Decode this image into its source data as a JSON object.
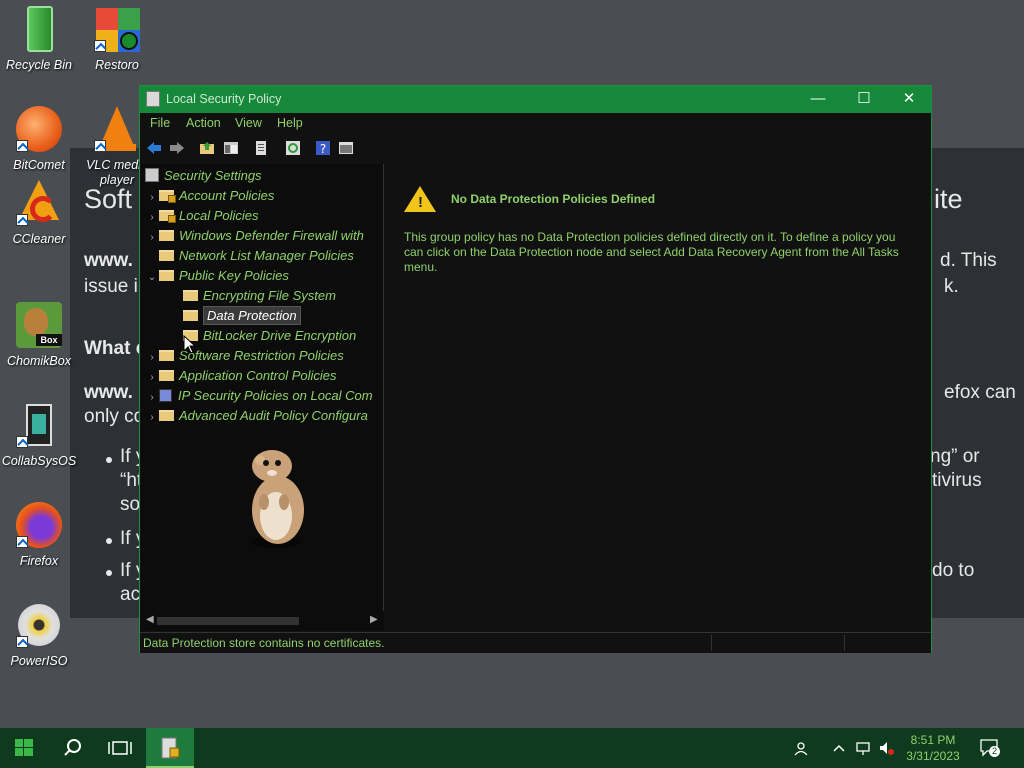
{
  "desktop_icons": [
    {
      "label": "Recycle Bin",
      "icon": "recycle-bin-icon"
    },
    {
      "label": "Restoro",
      "icon": "restoro-icon"
    },
    {
      "label": "BitComet",
      "icon": "bitcomet-icon"
    },
    {
      "label": "VLC media player",
      "icon": "vlc-icon"
    },
    {
      "label": "CCleaner",
      "icon": "ccleaner-icon"
    },
    {
      "label": "ChomikBox",
      "icon": "chomikbox-icon"
    },
    {
      "label": "CollabSysOS",
      "icon": "collabsysos-icon"
    },
    {
      "label": "Firefox",
      "icon": "firefox-icon"
    },
    {
      "label": "PowerISO",
      "icon": "poweriso-icon"
    }
  ],
  "background_page": {
    "fragments": [
      "Soft",
      "ite",
      "www.",
      "d. This",
      "issue i",
      "k.",
      "What c",
      "www.",
      "efox can",
      "only co",
      "If y",
      "ng” or",
      "“ht",
      "tivirus",
      "so",
      "If y",
      "If y",
      "do to",
      "ac"
    ]
  },
  "window": {
    "title": "Local Security Policy",
    "controls": {
      "minimize": "—",
      "maximize": "☐",
      "close": "✕"
    },
    "menu": [
      "File",
      "Action",
      "View",
      "Help"
    ],
    "tree": {
      "root": "Security Settings",
      "items": [
        {
          "label": "Account Policies",
          "level": 1,
          "expand": "›"
        },
        {
          "label": "Local Policies",
          "level": 1,
          "expand": "›"
        },
        {
          "label": "Windows Defender Firewall with",
          "level": 1,
          "expand": "›"
        },
        {
          "label": "Network List Manager Policies",
          "level": 1,
          "expand": ""
        },
        {
          "label": "Public Key Policies",
          "level": 1,
          "expand": "⌄"
        },
        {
          "label": "Encrypting File System",
          "level": 2,
          "expand": ""
        },
        {
          "label": "Data Protection",
          "level": 2,
          "expand": "",
          "selected": true
        },
        {
          "label": "BitLocker Drive Encryption",
          "level": 2,
          "expand": ""
        },
        {
          "label": "Software Restriction Policies",
          "level": 1,
          "expand": "›"
        },
        {
          "label": "Application Control Policies",
          "level": 1,
          "expand": "›"
        },
        {
          "label": "IP Security Policies on Local Com",
          "level": 1,
          "expand": "›"
        },
        {
          "label": "Advanced Audit Policy Configura",
          "level": 1,
          "expand": "›"
        }
      ]
    },
    "detail": {
      "title": "No Data Protection Policies Defined",
      "body": "This group policy has no Data Protection policies defined directly on it.  To define a policy you can click on the Data Protection node and select Add Data Recovery Agent from the All Tasks menu."
    },
    "status": "Data Protection store contains no certificates."
  },
  "taskbar": {
    "time": "8:51 PM",
    "date": "3/31/2023",
    "notifications": "2"
  },
  "colors": {
    "accent": "#15883a",
    "text_green": "#8fd16a",
    "taskbar": "#0e3a1e"
  }
}
